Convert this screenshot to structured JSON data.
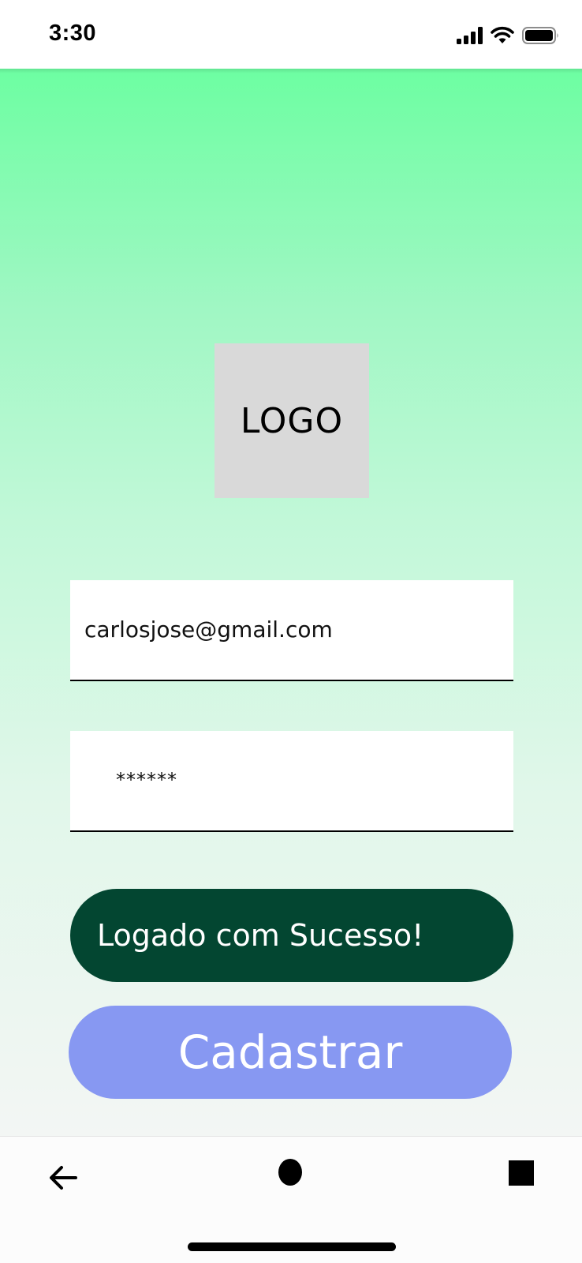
{
  "status_bar": {
    "time": "3:30",
    "icons": [
      "signal-icon",
      "wifi-icon",
      "battery-icon"
    ]
  },
  "logo": {
    "text": "LOGO"
  },
  "form": {
    "email_value": "carlosjose@gmail.com",
    "password_value": "******"
  },
  "buttons": {
    "login_label": "Logado com Sucesso!",
    "register_label": "Cadastrar"
  },
  "nav_bar": {
    "icons": [
      "back-arrow-icon",
      "home-circle-icon",
      "recent-apps-square-icon"
    ]
  },
  "colors": {
    "gradient_top": "#6dfea2",
    "gradient_bottom": "#f3f6f4",
    "login_button": "#034631",
    "register_button": "#8798f2",
    "logo_placeholder": "#d9d9d9"
  }
}
